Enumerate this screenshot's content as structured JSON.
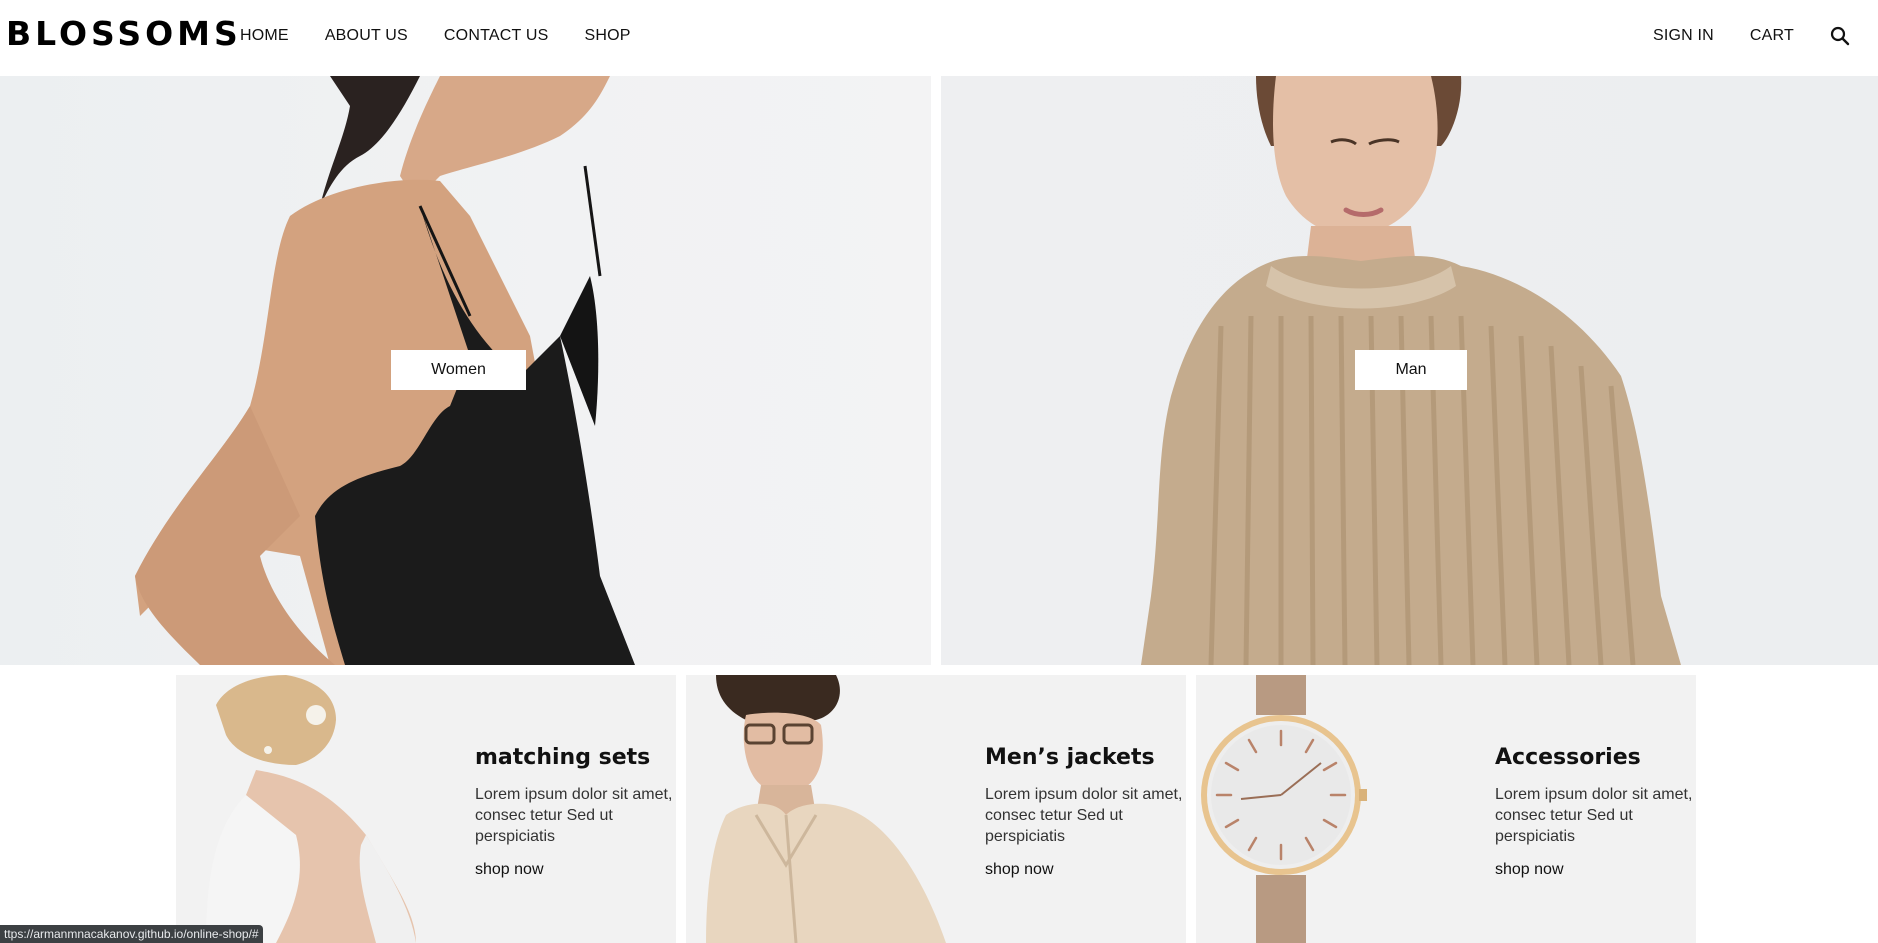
{
  "brand": {
    "logo": "BLOSSOMS"
  },
  "nav": {
    "items": [
      {
        "label": "HOME"
      },
      {
        "label": "ABOUT US"
      },
      {
        "label": "CONTACT US"
      },
      {
        "label": "SHOP"
      }
    ],
    "sign_in": "SIGN IN",
    "cart": "CART",
    "search_icon": "search-icon"
  },
  "hero": {
    "women_label": "Women",
    "man_label": "Man"
  },
  "categories": [
    {
      "title": "matching sets",
      "desc": "Lorem ipsum dolor sit amet, consec tetur Sed ut perspiciatis",
      "link": "shop now"
    },
    {
      "title": "Men’s jackets",
      "desc": "Lorem ipsum dolor sit amet, consec tetur Sed ut perspiciatis",
      "link": "shop now"
    },
    {
      "title": "Accessories",
      "desc": "Lorem ipsum dolor sit amet, consec tetur Sed ut perspiciatis",
      "link": "shop now"
    }
  ],
  "status_bar": {
    "url": "ttps://armanmnacakanov.github.io/online-shop/#"
  }
}
